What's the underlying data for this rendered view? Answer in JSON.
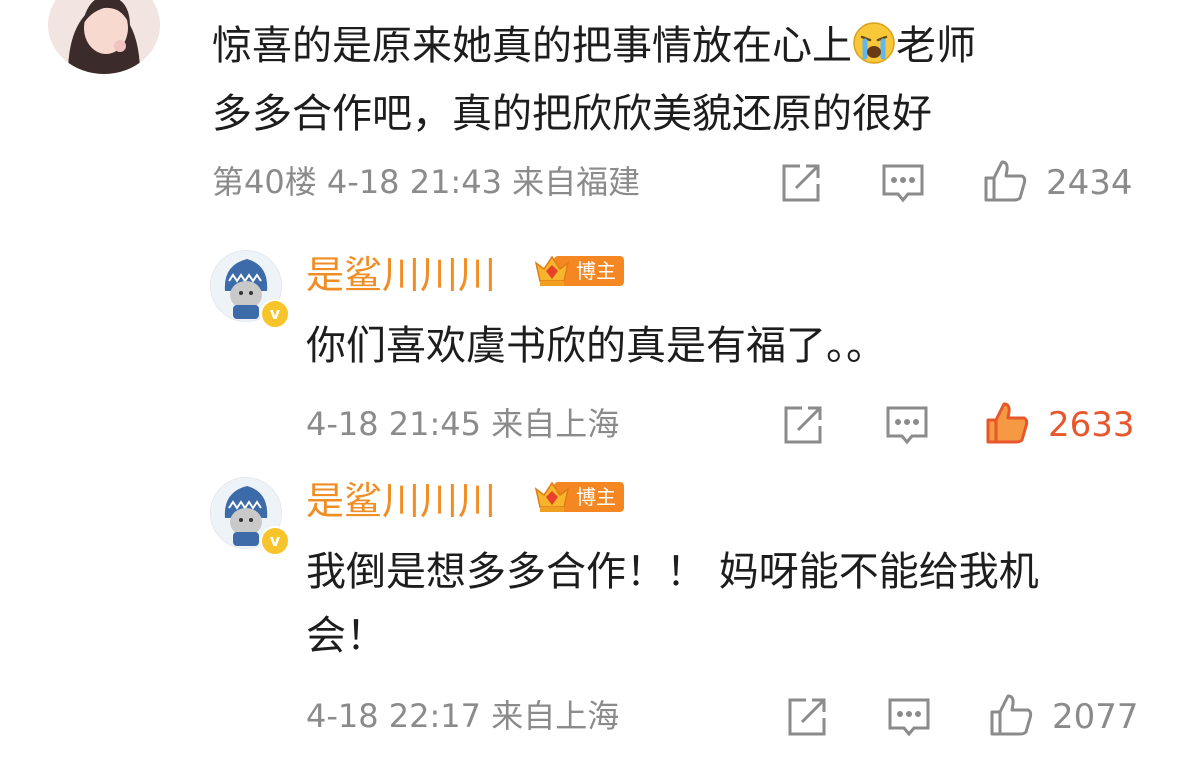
{
  "comment": {
    "text_line1": "惊喜的是原来她真的把事情放在心上",
    "emoji": "crying-face-icon",
    "text_line1_tail": "老师",
    "text_line2": "多多合作吧，真的把欣欣美貌还原的很好",
    "floor": "第40楼",
    "time": "4-18 21:43",
    "location": "来自福建",
    "like_count": "2434"
  },
  "replies": [
    {
      "username": "是鲨川川川",
      "badge": "博主",
      "verified_mark": "v",
      "text_lines": [
        "你们喜欢虞书欣的真是有福了。。"
      ],
      "time": "4-18 21:45",
      "location": "来自上海",
      "like_count": "2633",
      "liked": true
    },
    {
      "username": "是鲨川川川",
      "badge": "博主",
      "verified_mark": "v",
      "text_lines": [
        "我倒是想多多合作！！ 妈呀能不能给我机",
        "会！"
      ],
      "time": "4-18 22:17",
      "location": "来自上海",
      "like_count": "2077",
      "liked": false
    }
  ],
  "colors": {
    "accent_username": "#f08d24",
    "liked": "#e8572b",
    "meta_gray": "#8b8b8b",
    "badge_bg": "#f58723"
  }
}
